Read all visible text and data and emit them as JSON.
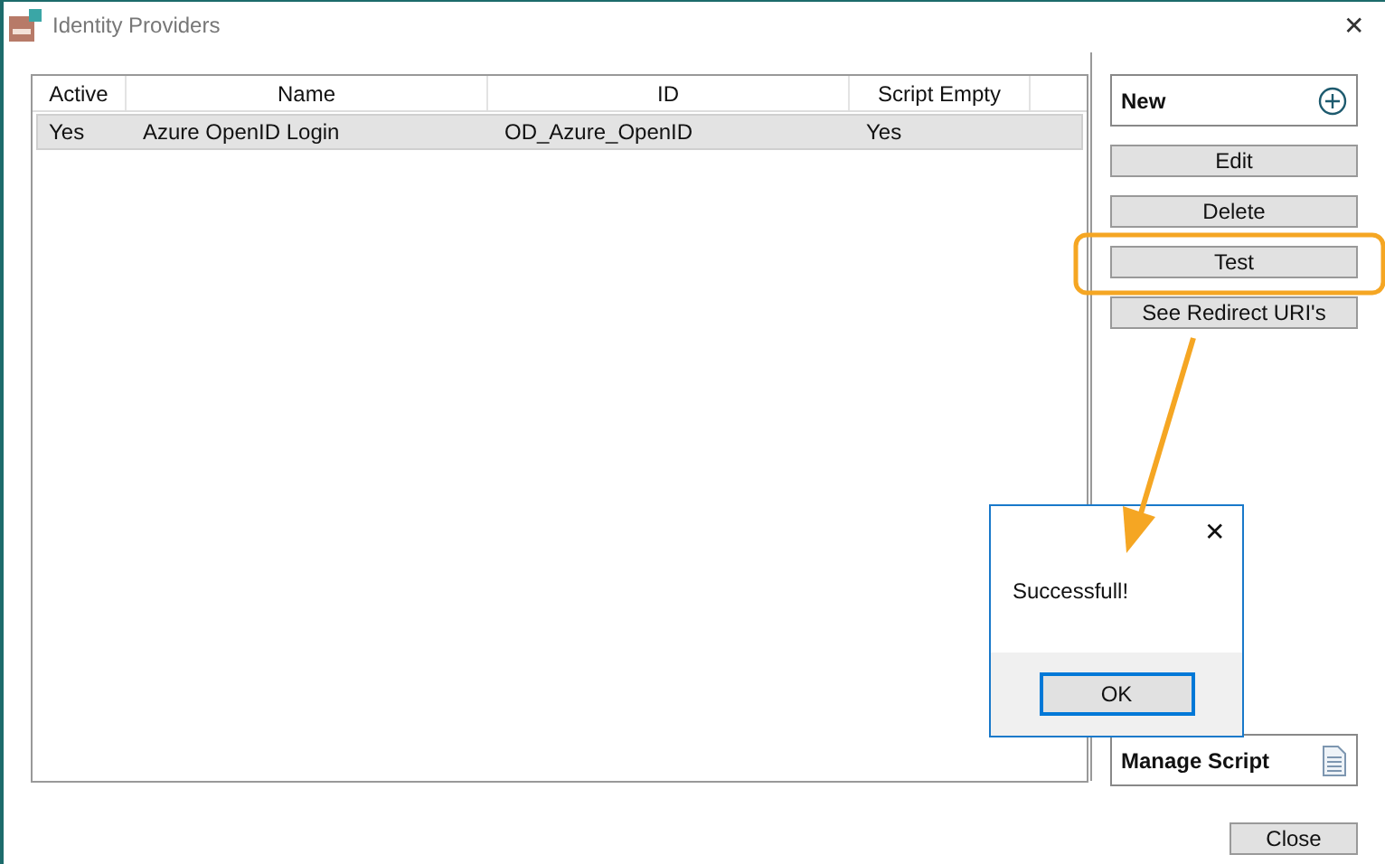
{
  "window": {
    "title": "Identity Providers",
    "close": "✕"
  },
  "table": {
    "columns": [
      "Active",
      "Name",
      "ID",
      "Script Empty"
    ],
    "rows": [
      {
        "selected": true,
        "cells": [
          "Yes",
          "Azure OpenID Login",
          "OD_Azure_OpenID",
          "Yes"
        ]
      }
    ]
  },
  "actions": {
    "new": "New",
    "buttons": [
      "Edit",
      "Delete",
      "Test",
      "See Redirect URI's"
    ],
    "manage_script": "Manage Script"
  },
  "close_button": "Close",
  "message_box": {
    "close": "✕",
    "message": "Successfull!",
    "ok": "OK"
  }
}
